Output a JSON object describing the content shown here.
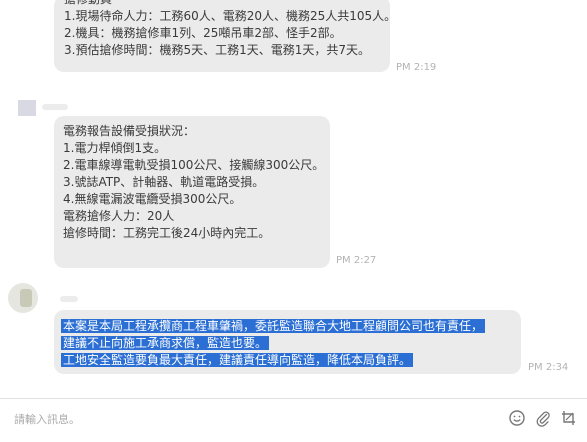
{
  "messages": [
    {
      "lines": [
        "搶修動員",
        "1.現場待命人力：工務60人、電務20人、機務25人共105人。",
        "2.機具：機務搶修車1列、25噸吊車2部、怪手2部。",
        "3.預估搶修時間：機務5天、工務1天、電務1天，共7天。"
      ],
      "time": "PM 2:19"
    },
    {
      "lines": [
        "電務報告設備受損狀況：",
        "1.電力桿傾倒1支。",
        "2.電車線導電軌受損100公尺、接觸線300公尺。",
        "3.號誌ATP、計軸器、軌道電路受損。",
        "4.無線電漏波電纜受損300公尺。",
        "電務搶修人力：20人",
        "搶修時間：工務完工後24小時內完工。"
      ],
      "time": "PM 2:27"
    },
    {
      "lines": [
        "本案是本局工程承攬商工程車肇禍，委託監造聯合大地工程顧問公司也有責任，",
        "建議不止向施工承商求償，監造也要。",
        "工地安全監造要負最大責任，建議責任導向監造，降低本局負評。"
      ],
      "time": "PM 2:34"
    }
  ],
  "input": {
    "placeholder": "請輸入訊息。"
  },
  "toolbar": {
    "icons": [
      "emoji-icon",
      "attach-icon",
      "scissors-icon"
    ]
  },
  "colors": {
    "bubble": "#ebebeb",
    "selection_highlight": "#2b6fd4",
    "timestamp": "#b3b3b3"
  }
}
